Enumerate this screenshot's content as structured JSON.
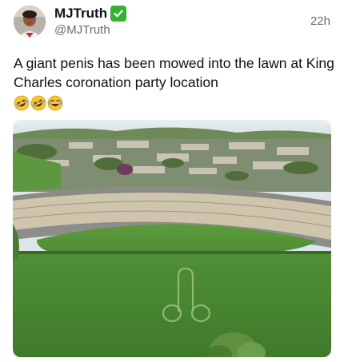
{
  "tweet": {
    "display_name": "MJTruth",
    "handle": "@MJTruth",
    "timestamp": "22h",
    "text": "A giant penis has been mowed into the lawn at King Charles coronation party location",
    "emojis": [
      "rofl-emoji",
      "rofl-emoji",
      "joy-emoji"
    ]
  },
  "colors": {
    "verified": "#34b233",
    "secondary_text": "#6b6b6b",
    "lawn": "#4f8d37"
  },
  "icons": {
    "verified": "verified-check-icon"
  }
}
